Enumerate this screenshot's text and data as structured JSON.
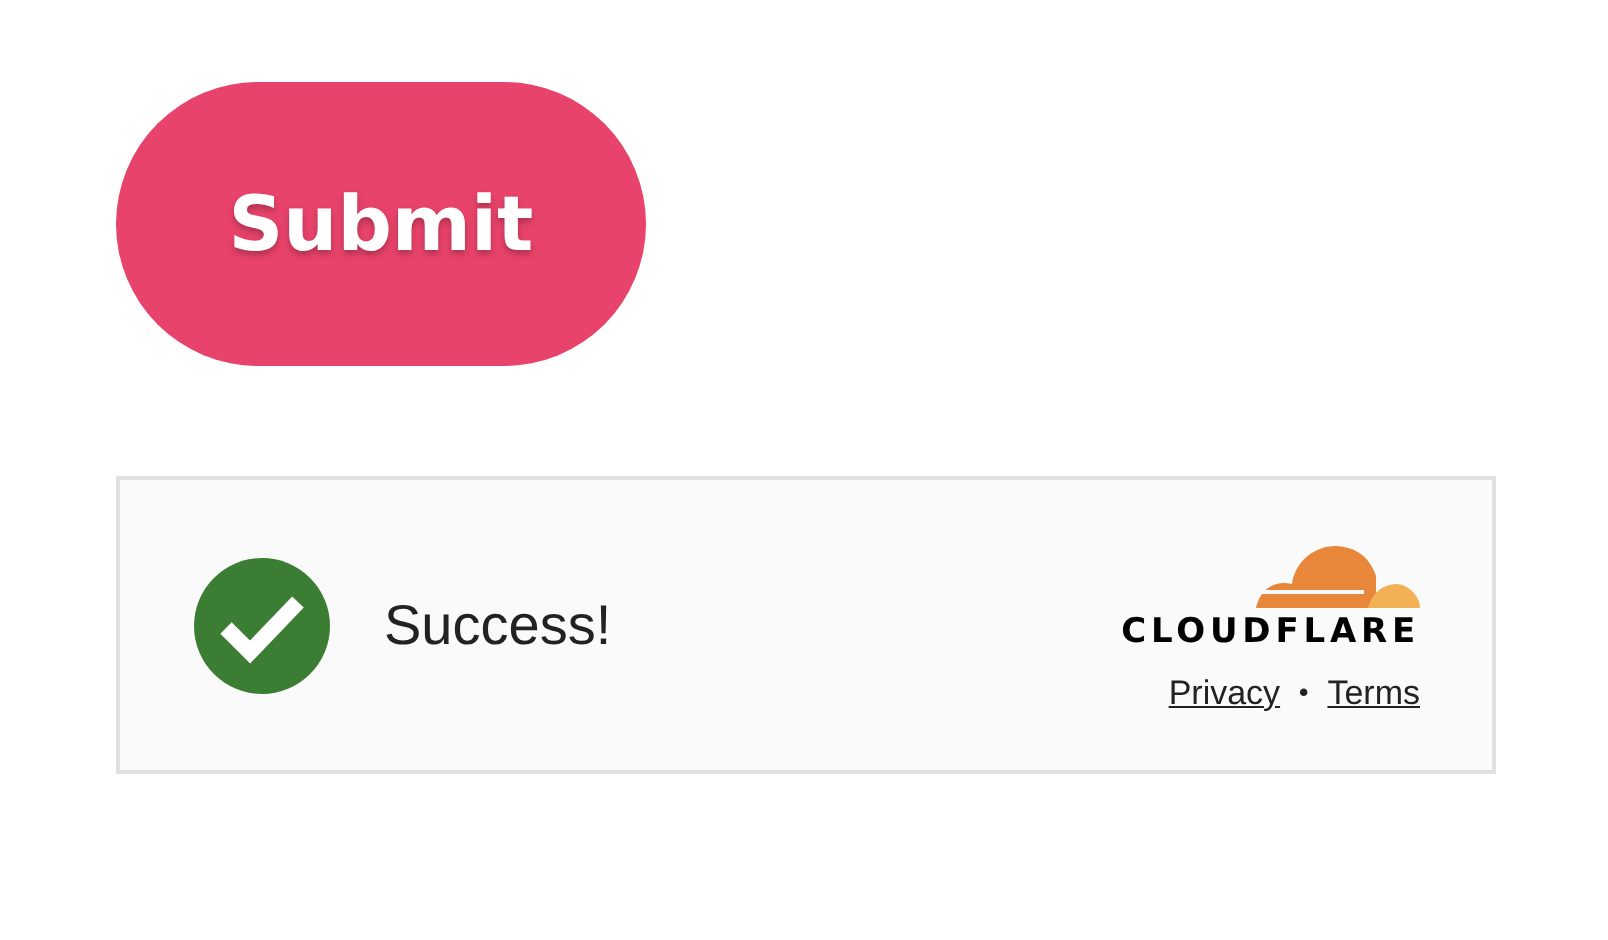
{
  "submit_button": {
    "label": "Submit"
  },
  "widget": {
    "status": {
      "success": true,
      "text": "Success!"
    },
    "brand": {
      "wordmark": "CLOUDFLARE"
    },
    "links": [
      {
        "label": "Privacy"
      },
      {
        "label": "Terms"
      }
    ],
    "separator": "•"
  }
}
